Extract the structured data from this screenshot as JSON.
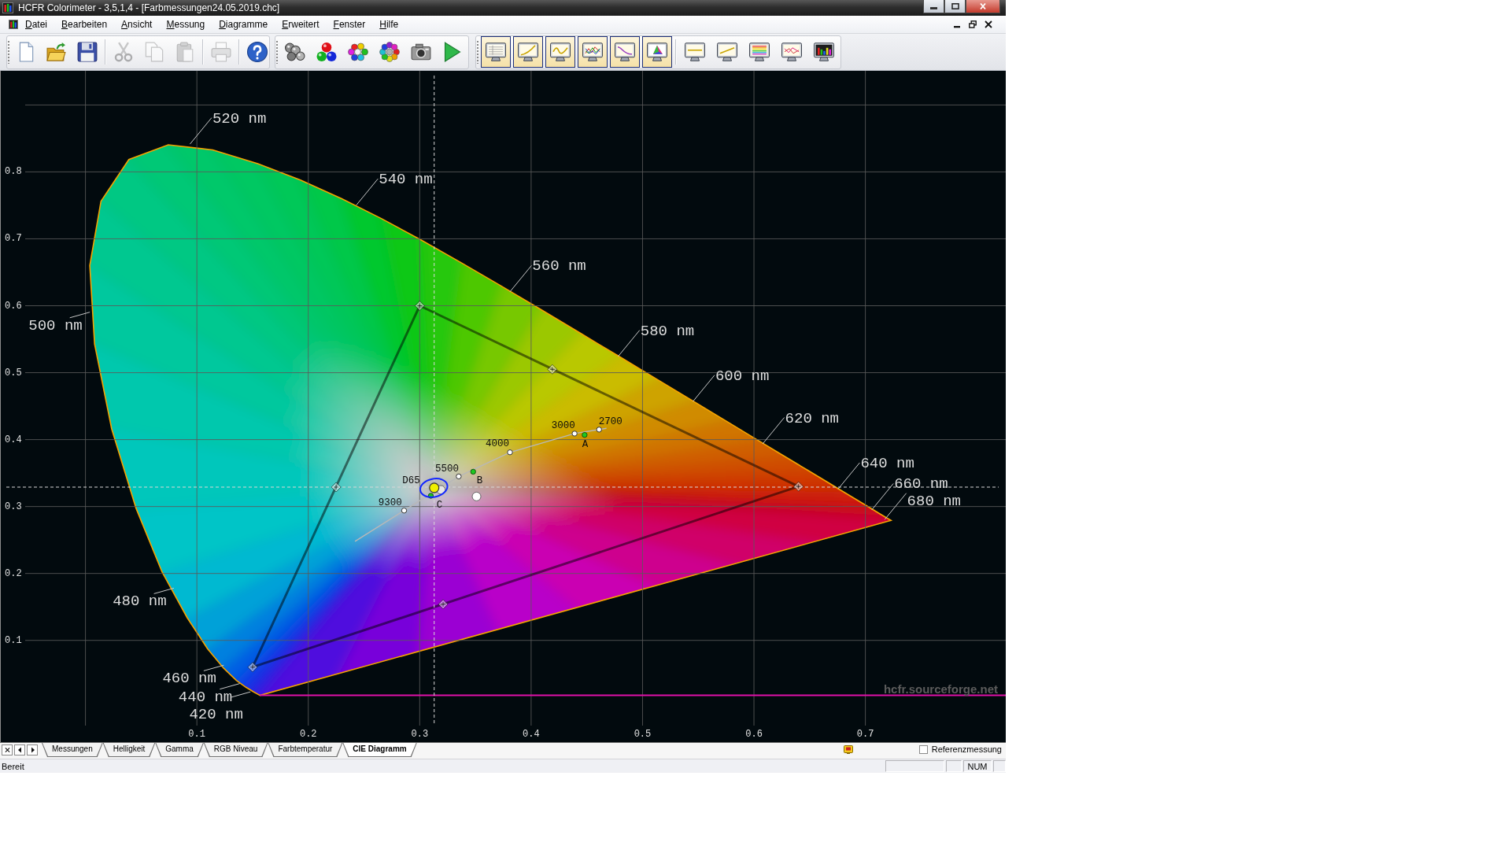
{
  "window": {
    "title": "HCFR Colorimeter - 3,5,1,4 - [Farbmessungen24.05.2019.chc]"
  },
  "menu": {
    "items": [
      "Datei",
      "Bearbeiten",
      "Ansicht",
      "Messung",
      "Diagramme",
      "Erweitert",
      "Fenster",
      "Hilfe"
    ]
  },
  "toolbar": {
    "groups": [
      [
        {
          "disabled": false
        },
        {
          "disabled": false
        },
        {
          "disabled": false
        },
        {
          "disabled": true
        },
        {
          "disabled": true
        },
        {
          "disabled": true
        },
        {
          "disabled": true
        },
        {
          "disabled": false
        }
      ],
      [
        {
          "disabled": false
        },
        {
          "disabled": false
        },
        {
          "disabled": false
        },
        {
          "disabled": false
        },
        {
          "disabled": false
        },
        {
          "disabled": false
        }
      ],
      [
        {
          "on": true
        },
        {
          "on": true
        },
        {
          "on": true
        },
        {
          "on": true
        },
        {
          "on": true
        },
        {
          "on": true
        },
        {
          "on": false
        },
        {
          "on": false
        },
        {
          "on": false
        },
        {
          "on": false
        },
        {
          "on": false
        }
      ]
    ]
  },
  "chart": {
    "chart_data": {
      "type": "scatter",
      "xlim": [
        -0.076,
        0.826
      ],
      "ylim": [
        -0.052,
        0.951
      ],
      "xticks": [
        0.1,
        0.2,
        0.3,
        0.4,
        0.5,
        0.6,
        0.7
      ],
      "yticks": [
        0.1,
        0.2,
        0.3,
        0.4,
        0.5,
        0.6,
        0.7,
        0.8
      ],
      "grid": true,
      "series": [
        {
          "x": [
            0.64,
            0.3,
            0.15
          ],
          "values": [
            0.33,
            0.6,
            0.06
          ]
        },
        {
          "x": [
            0.419,
            0.225,
            0.321
          ],
          "values": [
            0.505,
            0.329,
            0.154
          ]
        },
        {
          "color": "#ffffff",
          "x": [
            0.286,
            0.335,
            0.381,
            0.439,
            0.461
          ],
          "values": [
            0.294,
            0.345,
            0.381,
            0.409,
            0.415
          ]
        },
        {
          "color": "#1ec81e",
          "x": [
            0.448,
            0.348,
            0.31
          ],
          "values": [
            0.407,
            0.352,
            0.316
          ]
        },
        {
          "color": "#e6e6e6",
          "x": [
            0.319
          ],
          "values": [
            0.325
          ]
        },
        {
          "color": "#f0f000",
          "x": [
            0.313
          ],
          "values": [
            0.328
          ]
        },
        {
          "color": "#ffffff",
          "x": [
            0.351
          ],
          "values": [
            0.315
          ]
        }
      ],
      "ref_lines": [
        {
          "axis": "x",
          "value": 0.313
        },
        {
          "axis": "y",
          "value": 0.329
        }
      ],
      "annotations": [
        "520 nm",
        "540 nm",
        "560 nm",
        "500 nm",
        "580 nm",
        "600 nm",
        "620 nm",
        "2700",
        "3000",
        "4000",
        "A",
        "5500",
        "B",
        "D65",
        "640 nm",
        "9300",
        "C",
        "660 nm",
        "680 nm",
        "480 nm",
        "460 nm",
        "440 nm",
        "420 nm"
      ]
    },
    "watermark": "hcfr.sourceforge.net"
  },
  "tabs": [
    {
      "label": "Messungen",
      "selected": false
    },
    {
      "label": "Helligkeit",
      "selected": false
    },
    {
      "label": "Gamma",
      "selected": false
    },
    {
      "label": "RGB Niveau",
      "selected": false
    },
    {
      "label": "Farbtemperatur",
      "selected": false
    },
    {
      "label": "CIE Diagramm",
      "selected": true
    }
  ],
  "reference_checkbox": {
    "label": "Referenzmessung",
    "checked": false
  },
  "status_bar": {
    "message": "Bereit",
    "indicator": "NUM"
  }
}
